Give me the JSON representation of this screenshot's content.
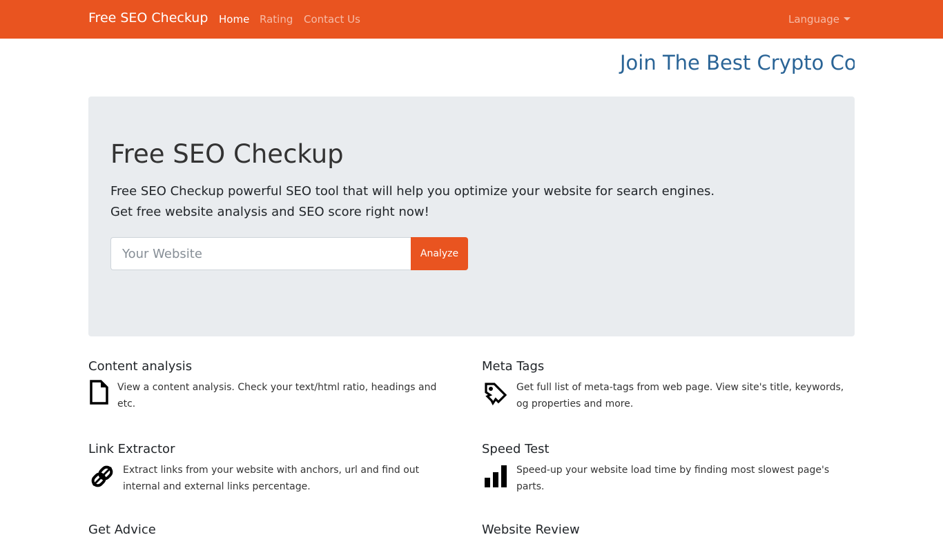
{
  "navbar": {
    "brand": "Free SEO Checkup",
    "links": [
      "Home",
      "Rating",
      "Contact Us"
    ],
    "language": "Language",
    "color": "#e95420"
  },
  "marquee": {
    "text": "Join The Best Crypto Co"
  },
  "hero": {
    "title": "Free SEO Checkup",
    "lead_line1": "Free SEO Checkup powerful SEO tool that will help you optimize your website for search engines.",
    "lead_line2": "Get free website analysis and SEO score right now!",
    "input_placeholder": "Your Website",
    "button_label": "Analyze"
  },
  "features": [
    {
      "title": "Content analysis",
      "icon": "file-icon",
      "description": "View a content analysis. Check your text/html ratio, headings and etc."
    },
    {
      "title": "Meta Tags",
      "icon": "tag-icon",
      "description": "Get full list of meta-tags from web page. View site's title, keywords, og properties and more."
    },
    {
      "title": "Link Extractor",
      "icon": "link-icon",
      "description": "Extract links from your website with anchors, url and find out internal and external links percentage."
    },
    {
      "title": "Speed Test",
      "icon": "bar-chart-icon",
      "description": "Speed-up your website load time by finding most slowest page's parts."
    },
    {
      "title": "Get Advice"
    },
    {
      "title": "Website Review"
    }
  ]
}
